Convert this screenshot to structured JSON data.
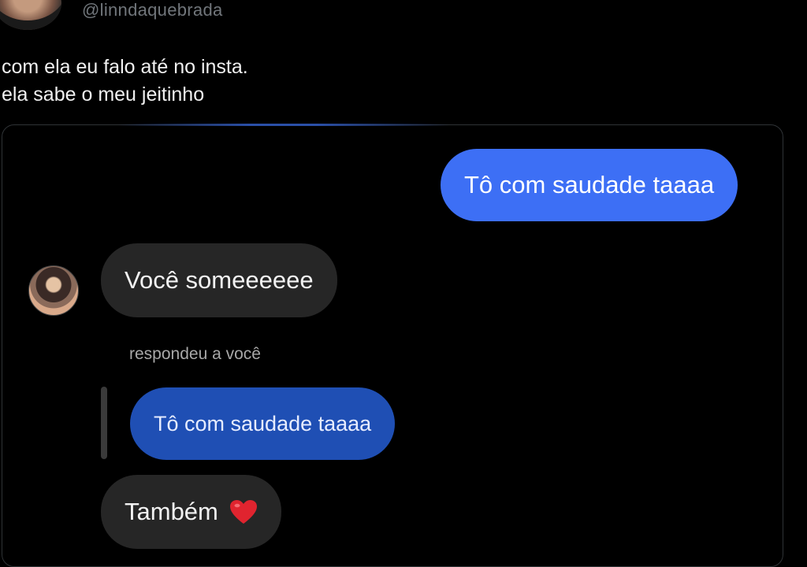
{
  "tweet": {
    "handle": "@linndaquebrada",
    "text_line_1": "com ela eu falo até no insta.",
    "text_line_2": "ela sabe o meu jeitinho"
  },
  "chat": {
    "sent_message": "Tô com saudade taaaa",
    "received_message_1": "Você someeeeee",
    "reply_caption": "respondeu a você",
    "quoted_message": "Tô com saudade taaaa",
    "received_message_2": "Também",
    "received_message_2_emoji": "heart-icon"
  },
  "colors": {
    "background": "#000000",
    "sent_bubble": "#3d6ff5",
    "received_bubble": "#262626",
    "quoted_bubble": "#1f4fb4",
    "handle_text": "#71767b",
    "heart": "#e0242f"
  }
}
